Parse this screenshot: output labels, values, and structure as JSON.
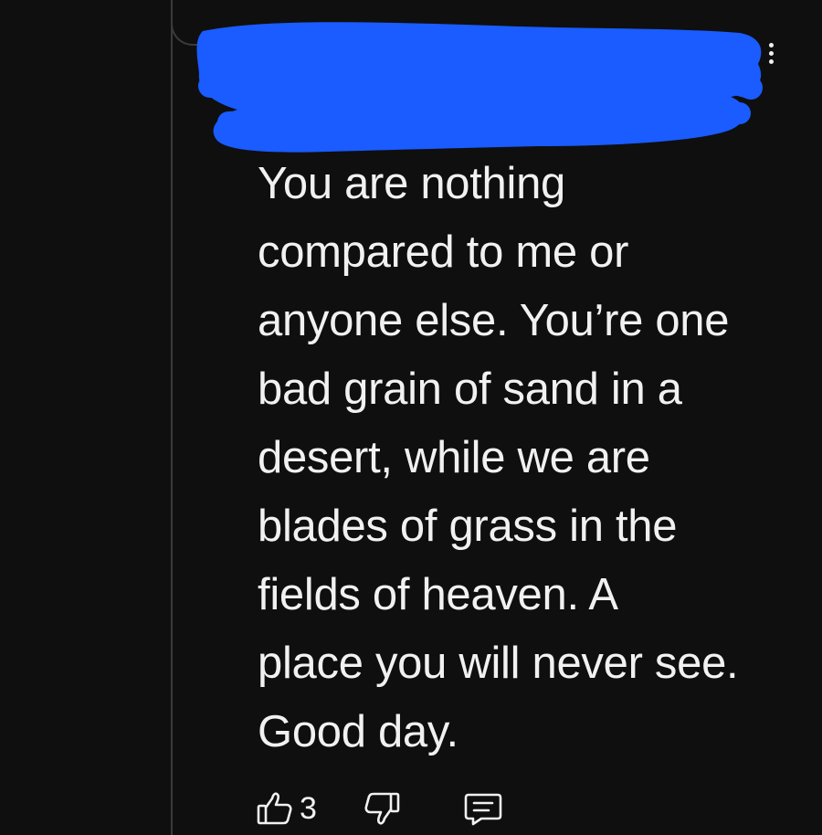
{
  "comment": {
    "lines": [
      "You are nothing",
      "compared to me or",
      "anyone else. You’re one",
      "bad grain of sand in a",
      "desert, while we are",
      "blades of grass in the",
      "fields of heaven. A",
      "place you will never see.",
      "Good day."
    ],
    "like_count": "3"
  },
  "icons": {
    "more": "more-vert-icon",
    "like": "thumbs-up-icon",
    "dislike": "thumbs-down-icon",
    "reply": "comment-reply-icon"
  },
  "colors": {
    "background": "#0f0f0f",
    "text": "#f1f1f1",
    "redaction": "#1a5cff",
    "thread_line": "#3a3a3a"
  }
}
